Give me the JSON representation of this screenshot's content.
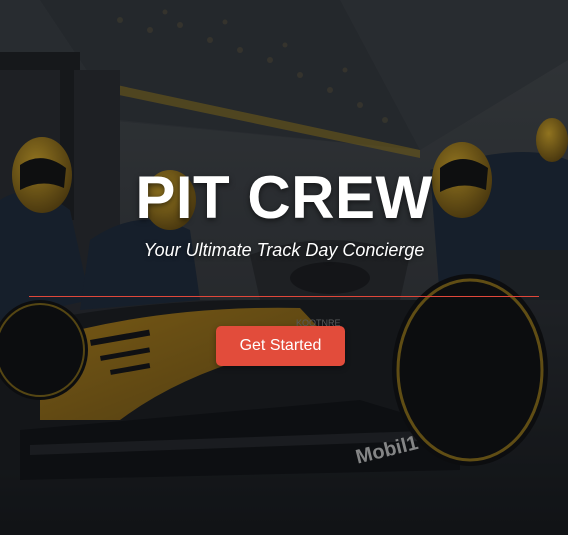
{
  "hero": {
    "title": "PIT CREW",
    "subtitle": "Your Ultimate Track Day Concierge",
    "cta_label": "Get Started"
  },
  "background": {
    "livery_text": "Mobil1",
    "nose_text": "KOOTNRE"
  },
  "colors": {
    "accent": "#e24c3b",
    "divider": "#e0473a",
    "car_yellow": "#d8a21c",
    "car_dark": "#15171b"
  }
}
